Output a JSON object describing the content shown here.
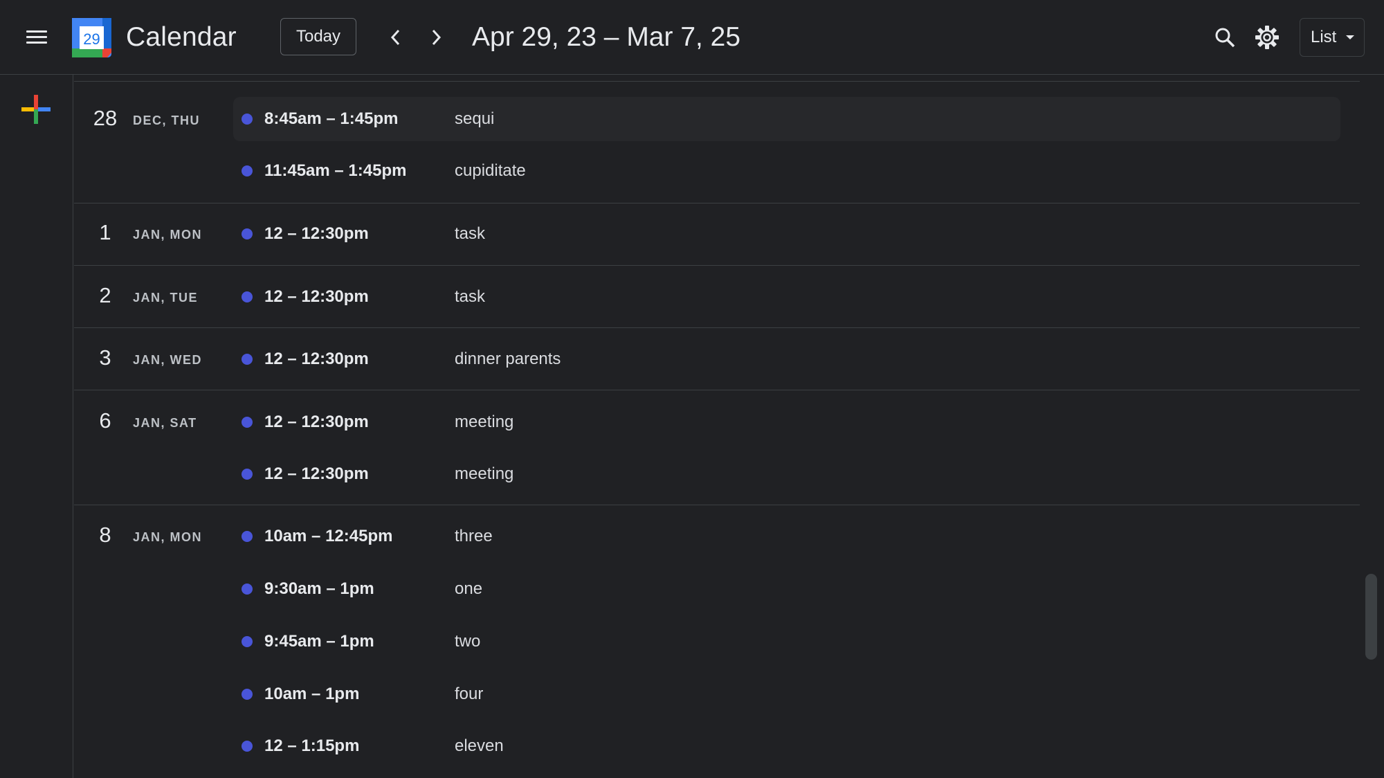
{
  "header": {
    "app_title": "Calendar",
    "logo_day": "29",
    "today_label": "Today",
    "date_range": "Apr 29, 23 – Mar 7, 25",
    "view_label": "List"
  },
  "icons": {
    "menu": "menu-icon",
    "prev": "chevron-left-icon",
    "next": "chevron-right-icon",
    "search": "search-icon",
    "settings": "gear-icon",
    "create": "plus-icon"
  },
  "colors": {
    "background": "#202124",
    "event_dot": "#4955d8",
    "divider": "#3c4043"
  },
  "agenda": {
    "days": [
      {
        "num": "28",
        "label": "DEC, THU",
        "events": [
          {
            "time": "8:45am – 1:45pm",
            "title": "sequi"
          },
          {
            "time": "11:45am – 1:45pm",
            "title": "cupiditate"
          }
        ]
      },
      {
        "num": "1",
        "label": "JAN, MON",
        "events": [
          {
            "time": "12 – 12:30pm",
            "title": "task"
          }
        ]
      },
      {
        "num": "2",
        "label": "JAN, TUE",
        "events": [
          {
            "time": "12 – 12:30pm",
            "title": "task"
          }
        ]
      },
      {
        "num": "3",
        "label": "JAN, WED",
        "events": [
          {
            "time": "12 – 12:30pm",
            "title": "dinner parents"
          }
        ]
      },
      {
        "num": "6",
        "label": "JAN, SAT",
        "events": [
          {
            "time": "12 – 12:30pm",
            "title": "meeting"
          },
          {
            "time": "12 – 12:30pm",
            "title": "meeting"
          }
        ]
      },
      {
        "num": "8",
        "label": "JAN, MON",
        "events": [
          {
            "time": "10am – 12:45pm",
            "title": "three"
          },
          {
            "time": "9:30am – 1pm",
            "title": "one"
          },
          {
            "time": "9:45am – 1pm",
            "title": "two"
          },
          {
            "time": "10am – 1pm",
            "title": "four"
          },
          {
            "time": "12 – 1:15pm",
            "title": "eleven"
          }
        ]
      }
    ]
  }
}
